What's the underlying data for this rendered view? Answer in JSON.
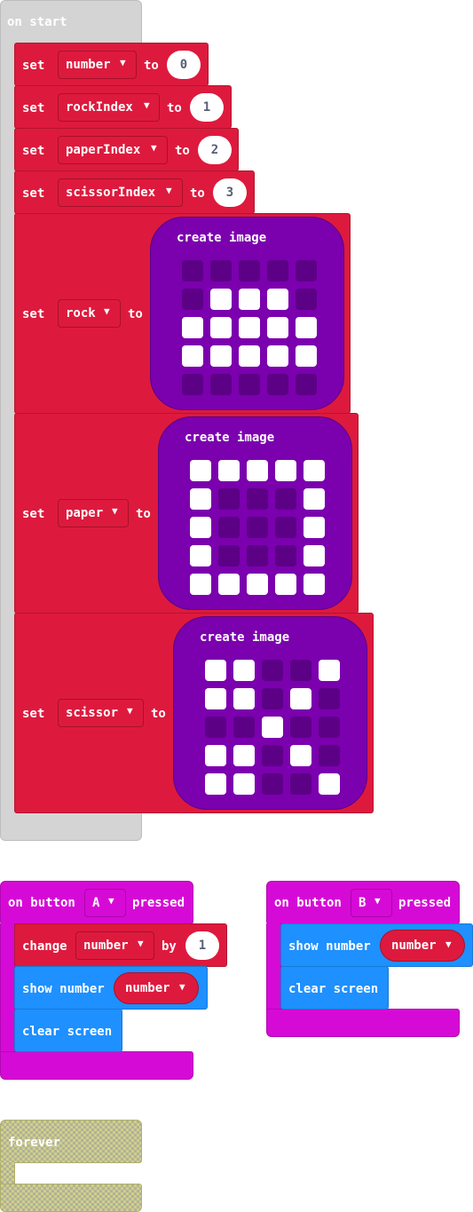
{
  "on_start": {
    "label": "on start",
    "statements": [
      {
        "set": "set",
        "variable": "number",
        "to": "to",
        "value": "0"
      },
      {
        "set": "set",
        "variable": "rockIndex",
        "to": "to",
        "value": "1"
      },
      {
        "set": "set",
        "variable": "paperIndex",
        "to": "to",
        "value": "2"
      },
      {
        "set": "set",
        "variable": "scissorIndex",
        "to": "to",
        "value": "3"
      },
      {
        "set": "set",
        "variable": "rock",
        "to": "to",
        "create_image": "create image",
        "leds": [
          [
            0,
            0,
            0,
            0,
            0
          ],
          [
            0,
            1,
            1,
            1,
            0
          ],
          [
            1,
            1,
            1,
            1,
            1
          ],
          [
            1,
            1,
            1,
            1,
            1
          ],
          [
            0,
            0,
            0,
            0,
            0
          ]
        ]
      },
      {
        "set": "set",
        "variable": "paper",
        "to": "to",
        "create_image": "create image",
        "leds": [
          [
            1,
            1,
            1,
            1,
            1
          ],
          [
            1,
            0,
            0,
            0,
            1
          ],
          [
            1,
            0,
            0,
            0,
            1
          ],
          [
            1,
            0,
            0,
            0,
            1
          ],
          [
            1,
            1,
            1,
            1,
            1
          ]
        ]
      },
      {
        "set": "set",
        "variable": "scissor",
        "to": "to",
        "create_image": "create image",
        "leds": [
          [
            1,
            1,
            0,
            0,
            1
          ],
          [
            1,
            1,
            0,
            1,
            0
          ],
          [
            0,
            0,
            1,
            0,
            0
          ],
          [
            1,
            1,
            0,
            1,
            0
          ],
          [
            1,
            1,
            0,
            0,
            1
          ]
        ]
      }
    ]
  },
  "button_a": {
    "on_button": "on button",
    "button": "A",
    "pressed": "pressed",
    "change": "change",
    "change_var": "number",
    "by": "by",
    "by_value": "1",
    "show_number": "show number",
    "show_var": "number",
    "clear_screen": "clear screen"
  },
  "button_b": {
    "on_button": "on button",
    "button": "B",
    "pressed": "pressed",
    "show_number": "show number",
    "show_var": "number",
    "clear_screen": "clear screen"
  },
  "forever": {
    "label": "forever"
  },
  "colors": {
    "variables": "#dd1a3d",
    "images": "#7b00ae",
    "input": "#d60ad6",
    "basic": "#1e90ff",
    "disabled": "#d4d4d4"
  },
  "icons": {
    "dropdown": "caret-down-icon"
  }
}
